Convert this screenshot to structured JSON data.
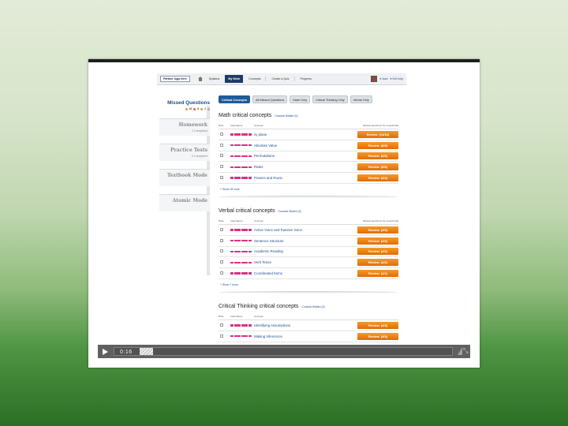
{
  "nav": {
    "logo": "Partner logo here",
    "links": [
      "Syllabus",
      "My Work",
      "Concepts",
      "Create a Quiz",
      "Progress"
    ],
    "active_index": 1,
    "user": "▾ Jose",
    "help": "▾ Get help"
  },
  "sidebar": {
    "title": "Missed Questions",
    "stats": [
      "46",
      "8",
      "4"
    ],
    "items": [
      {
        "name": "Homework",
        "sub": "2 Completed"
      },
      {
        "name": "Practice Tests",
        "sub": "0 Completed"
      },
      {
        "name": "Textbook Mode",
        "sub": ""
      },
      {
        "name": "Atomic Mode",
        "sub": ""
      }
    ]
  },
  "filters": [
    "Critical Concepts",
    "All Missed Questions",
    "Math Only",
    "Critical Thinking Only",
    "Verbal Only"
  ],
  "columns": {
    "hide": "Hide",
    "importance": "Importance",
    "concept": "Concept",
    "missed": "Missed questions for review/total"
  },
  "sections": [
    {
      "title": "Math critical concepts",
      "conceal": "Conceal Hidden (0)",
      "rows": [
        {
          "concept": "xy plane",
          "review": "Review",
          "count": "(14/16)"
        },
        {
          "concept": "Absolute Value",
          "review": "Review",
          "count": "(8/9)"
        },
        {
          "concept": "Permutations",
          "review": "Review",
          "count": "(6/6)"
        },
        {
          "concept": "Rates",
          "review": "Review",
          "count": "(6/6)"
        },
        {
          "concept": "Powers and Roots",
          "review": "Review",
          "count": "(4/4)"
        }
      ],
      "more": "+ Show 18 more"
    },
    {
      "title": "Verbal critical concepts",
      "conceal": "Conceal Hidden (0)",
      "rows": [
        {
          "concept": "Active Voice and Passive Voice",
          "review": "Review",
          "count": "(3/3)"
        },
        {
          "concept": "Sentence Structure",
          "review": "Review",
          "count": "(2/2)"
        },
        {
          "concept": "Academic Reading",
          "review": "Review",
          "count": "(2/2)"
        },
        {
          "concept": "Verb Tense",
          "review": "Review",
          "count": "(2/2)"
        },
        {
          "concept": "Coordinated Items",
          "review": "Review",
          "count": "(1/1)"
        }
      ],
      "more": "+ Show 7 more"
    },
    {
      "title": "Critical Thinking critical concepts",
      "conceal": "Conceal Hidden (0)",
      "rows": [
        {
          "concept": "Identifying Assumptions",
          "review": "Review",
          "count": "(3/3)"
        },
        {
          "concept": "Making Inferences",
          "review": "Review",
          "count": "(3/3)"
        }
      ],
      "more": ""
    }
  ],
  "video": {
    "time": "0:16"
  },
  "colors": {
    "accent": "#1f3a66",
    "review": "#e8780e",
    "importance": "#d63384"
  }
}
